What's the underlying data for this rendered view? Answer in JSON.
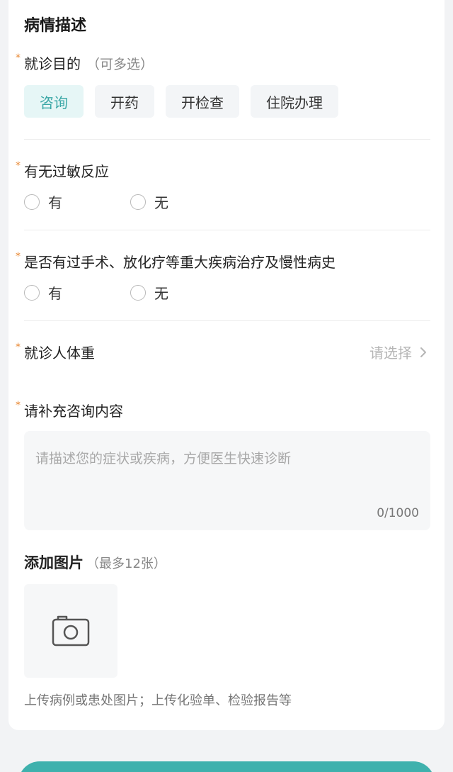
{
  "section": {
    "title": "病情描述"
  },
  "visit_purpose": {
    "label": "就诊目的",
    "hint": "（可多选）",
    "options": [
      "咨询",
      "开药",
      "开检查",
      "住院办理"
    ],
    "selected": "咨询"
  },
  "allergy": {
    "label": "有无过敏反应",
    "options": [
      "有",
      "无"
    ]
  },
  "history": {
    "label": "是否有过手术、放化疗等重大疾病治疗及慢性病史",
    "options": [
      "有",
      "无"
    ]
  },
  "weight": {
    "label": "就诊人体重",
    "placeholder": "请选择"
  },
  "consult": {
    "label": "请补充咨询内容",
    "placeholder": "请描述您的症状或疾病，方便医生快速诊断",
    "count": "0/1000"
  },
  "images": {
    "title": "添加图片",
    "hint": "（最多12张）",
    "note": "上传病例或患处图片；上传化验单、检验报告等"
  },
  "required_mark": "*",
  "colors": {
    "accent": "#3aa7a6",
    "star": "#e8852e",
    "button": "#3fb1ad"
  }
}
